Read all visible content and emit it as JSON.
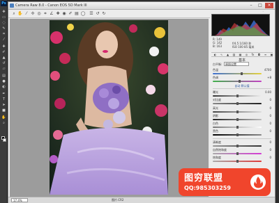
{
  "app": {
    "logo_text": "Ps"
  },
  "dialog": {
    "title": "Camera Raw 8.0  -  Canon EOS 5D Mark III",
    "window_buttons": [
      "–",
      "□",
      "×"
    ]
  },
  "toolbar": {
    "tools": [
      "zoom-icon",
      "hand-icon",
      "white-balance-icon",
      "color-sampler-icon",
      "target-adjust-icon",
      "crop-icon",
      "straighten-icon",
      "spot-removal-icon",
      "red-eye-icon",
      "adjustment-brush-icon",
      "graduated-filter-icon",
      "radial-filter-icon",
      "preferences-icon",
      "rotate-ccw-icon",
      "rotate-cw-icon"
    ]
  },
  "preview": {
    "zoom": "17.4%",
    "filename": "图片.CR2"
  },
  "readout": {
    "r": "R: 149",
    "g": "G: 142",
    "b": "B: 163",
    "camera_line1": "f/4.5   1/160 秒",
    "camera_line2": "ISO 100   85 毫米"
  },
  "panel": {
    "section_title": "基本",
    "white_balance_label": "白平衡:",
    "white_balance_value": "原照设置",
    "temperature_label": "色温",
    "temperature_value": "4700",
    "tint_label": "色调",
    "tint_value": "+8",
    "auto_link": "自动    默认值",
    "tone_rows": [
      {
        "label": "曝光",
        "value": "0.00"
      },
      {
        "label": "对比度",
        "value": "0"
      },
      {
        "label": "高光",
        "value": "0"
      },
      {
        "label": "阴影",
        "value": "0"
      },
      {
        "label": "白色",
        "value": "0"
      },
      {
        "label": "黑色",
        "value": "0"
      }
    ],
    "presence_rows": [
      {
        "label": "清晰度",
        "value": "0"
      },
      {
        "label": "自然饱和度",
        "value": "0"
      },
      {
        "label": "饱和度",
        "value": "0"
      }
    ]
  },
  "watermark": {
    "title": "图穷联盟",
    "qq": "QQ:985303259"
  },
  "colors": {
    "accent_red": "#f0452c",
    "dialog_bg": "#e9e9e9"
  }
}
